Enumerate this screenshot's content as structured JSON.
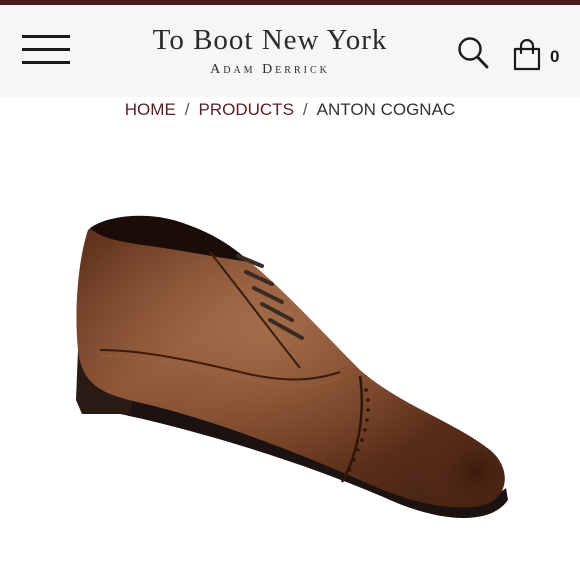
{
  "header": {
    "brand_title": "To Boot New York",
    "brand_subtitle": "Adam Derrick",
    "cart_count": "0"
  },
  "breadcrumb": {
    "items": [
      "HOME",
      "PRODUCTS",
      "ANTON COGNAC"
    ],
    "separator": "/"
  },
  "product": {
    "image_icon": "oxford-shoe-image",
    "color": "#6b3a22"
  },
  "colors": {
    "accent": "#4a1a1c",
    "link": "#5a1f22",
    "header_bg": "#f6f6f6"
  }
}
